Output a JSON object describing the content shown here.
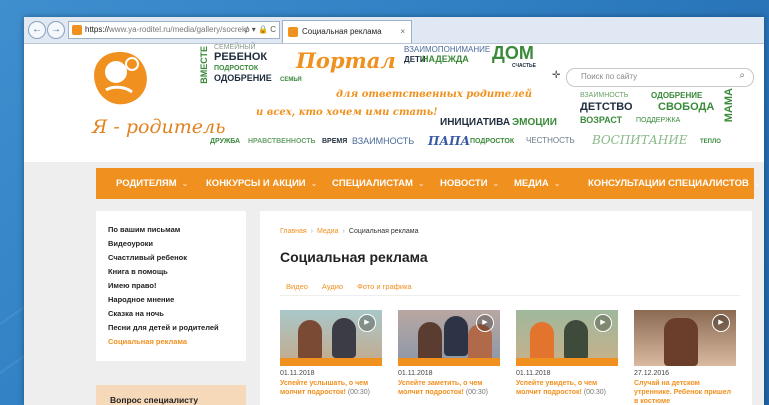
{
  "browser": {
    "address_https": "https://",
    "address_rest": "www.ya-roditel.ru/media/gallery/socrek/",
    "address_controls": "ρ ▾ 🔒 C",
    "tab_title": "Социальная реклама",
    "tab_close": "×"
  },
  "site": {
    "logo_text": "Я - родитель",
    "portal_title": "Портал",
    "slogan_1": "для ответственных родителей",
    "slogan_2": "и всех, кто хочем ими стать!",
    "word_cloud": {
      "w_vmeste": "ВМЕСТЕ",
      "w_semeyny": "СЕМЕЙНЫЙ",
      "w_rebenok": "РЕБЕНОК",
      "w_podrostok": "ПОДРОСТОК",
      "w_odobrenie": "ОДОБРЕНИЕ",
      "w_semya": "СЕМЬЯ",
      "w_vzaimoponimanie": "ВЗАИМОПОНИМАНИЕ",
      "w_deti": "ДЕТИ",
      "w_nadezhda": "НАДЕЖДА",
      "w_dom": "ДОМ",
      "w_schastye": "СЧАСТЬЕ",
      "w_vzaimnost_top": "ВЗАИМНОСТЬ",
      "w_odobrenie_2": "ОДОБРЕНИЕ",
      "w_detstvo": "ДЕТСТВО",
      "w_svoboda": "СВОБОДА",
      "w_vozrast": "ВОЗРАСТ",
      "w_podderzhka": "ПОДДЕРЖКА",
      "w_mama": "МАМА",
      "w_initsiativa": "ИНИЦИАТИВА",
      "w_emotsii": "ЭМОЦИИ",
      "w_druzhba": "ДРУЖБА",
      "w_nravstvennost": "НРАВСТВЕННОСТЬ",
      "w_vremya": "ВРЕМЯ",
      "w_vzaimnost": "ВЗАИМНОСТЬ",
      "w_papa": "ПАПА",
      "w_podrostok_2": "ПОДРОСТОК",
      "w_chestnost": "ЧЕСТНОСТЬ",
      "w_vospitanie": "ВОСПИТАНИЕ",
      "w_teplo": "ТЕПЛО"
    },
    "search_placeholder": "Поиск по сайту"
  },
  "menu": [
    "РОДИТЕЛЯМ",
    "КОНКУРСЫ И АКЦИИ",
    "СПЕЦИАЛИСТАМ",
    "НОВОСТИ",
    "МЕДИА",
    "КОНСУЛЬТАЦИИ СПЕЦИАЛИСТОВ"
  ],
  "sidebar": {
    "items": [
      "По вашим письмам",
      "Видеоуроки",
      "Счастливый ребенок",
      "Книга в помощь",
      "Имею право!",
      "Народное мнение",
      "Сказка на ночь",
      "Песни для детей и родителей",
      "Социальная реклама"
    ],
    "ask_title": "Вопрос специалисту"
  },
  "breadcrumb": [
    "Главная",
    "Медиа",
    "Социальная реклама"
  ],
  "breadcrumb_sep": "›",
  "page_title": "Социальная реклама",
  "filter_tabs": [
    "Видео",
    "Аудио",
    "Фото и графика"
  ],
  "cards": [
    {
      "date": "01.11.2018",
      "title": "Успейте услышать, о чем молчит подросток!",
      "duration": "(00:30)"
    },
    {
      "date": "01.11.2018",
      "title": "Успейте заметить, о чем молчит подросток!",
      "duration": "(00:30)"
    },
    {
      "date": "01.11.2018",
      "title": "Успейте увидеть, о чем молчит подросток!",
      "duration": "(00:30)"
    },
    {
      "date": "27.12.2016",
      "title": "Случай на детском утреннике. Ребенок пришел в костюме",
      "duration": ""
    }
  ],
  "icons": {
    "back": "←",
    "forward": "→",
    "search": "⌕",
    "play": "▶",
    "chevron": "⌄",
    "move_cursor": "✛"
  },
  "colors": {
    "accent": "#f0901e",
    "word_green": "#3a8a3a",
    "word_dark": "#1f2d3d"
  }
}
